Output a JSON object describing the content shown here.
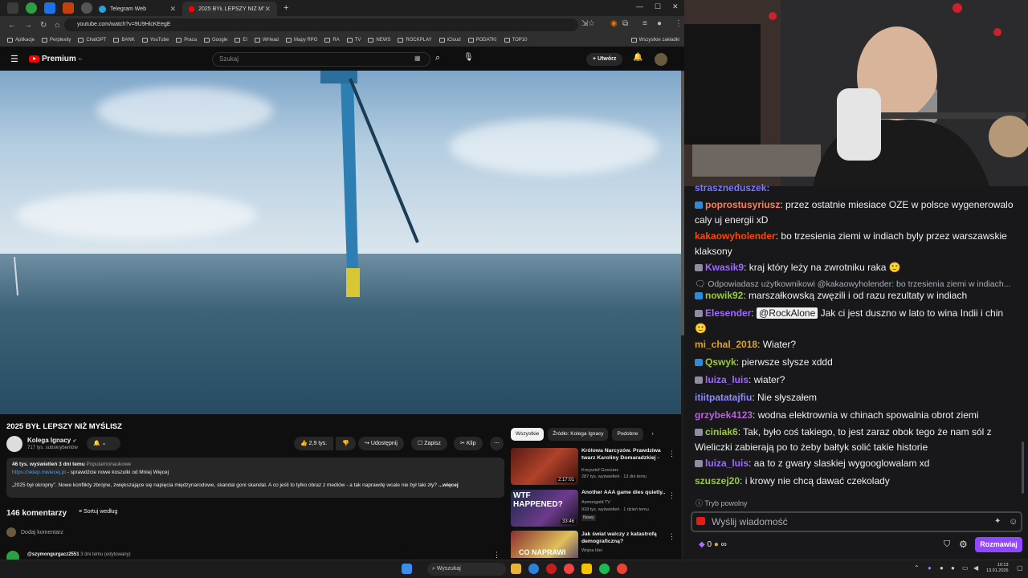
{
  "browser": {
    "tabs": [
      {
        "label": "Telegram Web"
      },
      {
        "label": "2025 BYŁ LEPSZY NIŻ MYŚLISZ"
      }
    ],
    "url": "youtube.com/watch?v=9U9HlcKEegE",
    "bookmarks": [
      "Aplikacje",
      "Perplexity",
      "ChatGPT",
      "BANK",
      "YouTube",
      "Praca",
      "Google",
      "EI",
      "WHead",
      "Mapy RPG",
      "RA",
      "TV",
      "NEWS",
      "ROCKPLAY",
      "iCloud",
      "PODATKI",
      "TOP10"
    ],
    "bookmarks_all": "Wszystkie zakładki"
  },
  "youtube": {
    "logo": "Premium",
    "logo_region": "PL",
    "search_placeholder": "Szukaj",
    "create_label": "Utwórz",
    "video_title": "2025 BYŁ LEPSZY NIŻ MYŚLISZ",
    "channel_name": "Kolega Ignacy",
    "channel_subs": "717 tys. subskrybentów",
    "likes": "2,9 tys.",
    "share_label": "Udostępnij",
    "save_label": "Zapisz",
    "clip_label": "Klip",
    "desc_meta": "46 tys. wyświetleń  3 dni temu",
    "desc_tag": "Popularnonaukowe",
    "desc_link": "https://sklep.mwiecej.pl",
    "desc_link_text": " - sprawdźcie nowe koszulki od Mniej Więcej",
    "desc_text": "„2025 był okropny”. Nowe konflikty zbrojne, zwiększające się napięcia międzynarodowe, skandal goni skandal. A co jeśli to tylko obraz z mediów - a tak naprawdę wcale nie był taki zły?",
    "desc_more": "...więcej",
    "comments_count": "146 komentarzy",
    "sort_label": "Sortuj według",
    "add_comment": "Dodaj komentarz",
    "first_comment_user": "@szymongurgacz2551",
    "first_comment_meta": "3 dni temu (edytowany)",
    "chips": [
      "Wszystkie",
      "Źródło: Kolega Ignacy",
      "Podobne"
    ],
    "recommendations": [
      {
        "title": "Królowa Narcyzów. Prawdziwa twarz Karoliny Domaradzkiej -",
        "channel": "Krzysztof Gonciarz",
        "meta": "287 tys. wyświetleń · 13 dni temu",
        "duration": "2:17:01",
        "thumb_text": ""
      },
      {
        "title": "Another AAA game dies quietly..",
        "channel": "Asmongold TV",
        "meta": "918 tys. wyświetleń · 1 dzień temu",
        "badge": "Nowy",
        "duration": "33:46",
        "thumb_text": "WTF HAPPENED?"
      },
      {
        "title": "Jak świat walczy z katastrofą demograficzną?",
        "channel": "Wojna Idei",
        "meta": "",
        "duration": "",
        "thumb_text": "CO NAPRAWI"
      }
    ]
  },
  "chat": {
    "partial_top": "straszneduszek:",
    "messages": [
      {
        "user": "poprostusyriusz",
        "color": "#ff7f50",
        "badge": "blue",
        "text": "przez ostatnie miesiace OZE w polsce wygenerowalo caly uj energii xD"
      },
      {
        "user": "kakaowyholender",
        "color": "#ff4500",
        "badge": "",
        "text": "bo trzesienia ziemi w indiach byly przez warszawskie klaksony"
      },
      {
        "user": "Kwasik9",
        "color": "#9d6bff",
        "badge": "mod",
        "text": "kraj który leży na zwrotniku raka"
      },
      {
        "user": "nowik92",
        "color": "#9acd32",
        "badge": "blue",
        "text": "marszałkowską zwęzili i od razu rezultaty w indiach",
        "reply": "Odpowiadasz użytkownikowi @kakaowyholender: bo trzesienia ziemi w indiach..."
      },
      {
        "user": "Elesender",
        "color": "#9d6bff",
        "badge": "mod",
        "mention": "@RockAlone",
        "text": "Jak ci jest duszno w lato to wina Indii i chin"
      },
      {
        "user": "mi_chal_2018",
        "color": "#daa520",
        "badge": "",
        "text": "Wiater?"
      },
      {
        "user": "Qswyk",
        "color": "#9acd32",
        "badge": "blue",
        "text": "pierwsze slysze xddd"
      },
      {
        "user": "luiza_luis",
        "color": "#9d6bff",
        "badge": "mod",
        "text": "wiater?"
      },
      {
        "user": "itiitpatatajfiu",
        "color": "#8a8aff",
        "badge": "",
        "text": "Nie słyszałem"
      },
      {
        "user": "grzybek4123",
        "color": "#b864d6",
        "badge": "",
        "text": "wodna elektrownia w chinach spowalnia obrot ziemi"
      },
      {
        "user": "ciniak6",
        "color": "#9acd32",
        "badge": "mod",
        "text": "Tak, było coś takiego, to jest zaraz obok tego że nam sól z Wieliczki zabierają po to żeby bałtyk solić  takie historie"
      },
      {
        "user": "luiza_luis",
        "color": "#9d6bff",
        "badge": "mod",
        "text": "aa to z gwary slaskiej wygooglowalam xd"
      },
      {
        "user": "szuszej20",
        "color": "#9acd32",
        "badge": "",
        "text": "i krowy nie chcą dawać czekolady"
      }
    ],
    "slow_mode": "Tryb powolny",
    "input_placeholder": "Wyślij wiadomość",
    "points": "0",
    "send_label": "Rozmawiaj"
  },
  "taskbar": {
    "search_placeholder": "Wyszukaj",
    "time": "10:13",
    "date": "13.01.2026"
  }
}
